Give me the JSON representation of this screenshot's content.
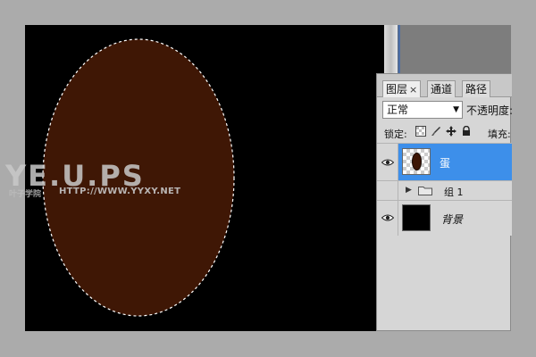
{
  "watermark": {
    "logo": "YE.U.PS",
    "subtitle": "叶子学院",
    "url": "HTTP://WWW.YYXY.NET"
  },
  "panel": {
    "tabs": [
      {
        "label": "图层",
        "active": true,
        "close": "×"
      },
      {
        "label": "通道",
        "active": false
      },
      {
        "label": "路径",
        "active": false
      }
    ],
    "blend_mode": "正常",
    "opacity_label": "不透明度:",
    "lock_label": "锁定:",
    "fill_label": "填充:",
    "lock_icons": [
      "lock-transparency-icon",
      "brush-icon",
      "move-icon",
      "lock-icon"
    ]
  },
  "layers": [
    {
      "name": "蛋",
      "selected": true,
      "visible": true,
      "thumb": "egg"
    },
    {
      "name": "组 1",
      "type": "group",
      "visible": false,
      "collapsed": true
    },
    {
      "name": "背景",
      "visible": true,
      "thumb": "black"
    }
  ],
  "colors": {
    "egg_fill": "#3f1705",
    "canvas_bg": "#000000",
    "selection_color": "#3d8fea"
  }
}
